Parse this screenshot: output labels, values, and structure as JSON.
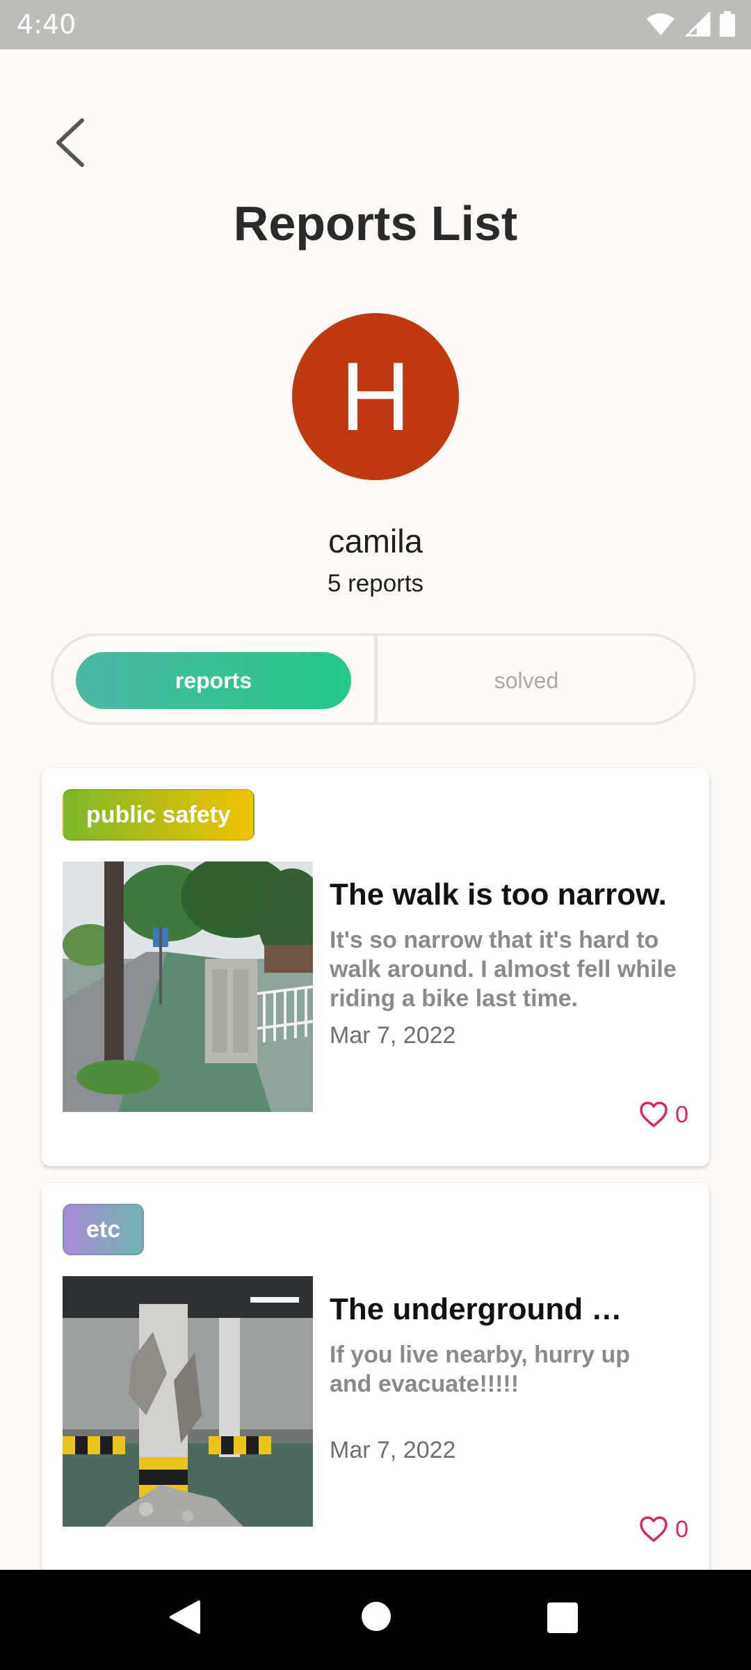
{
  "status_bar": {
    "time": "4:40",
    "icons": [
      "wifi-icon",
      "signal-icon",
      "battery-icon"
    ]
  },
  "header": {
    "back_icon": "chevron-left-icon",
    "title": "Reports List"
  },
  "profile": {
    "avatar_initial": "H",
    "avatar_color": "#C0380F",
    "name": "camila",
    "report_count": "5 reports"
  },
  "tabs": {
    "active": "reports",
    "items": [
      {
        "label": "reports"
      },
      {
        "label": "solved"
      }
    ]
  },
  "reports": [
    {
      "category": "public safety",
      "category_colors": [
        "#7DB82A",
        "#F2C200"
      ],
      "title": "The walk is too narrow.",
      "description": "It's so narrow that it's hard to walk around. I almost fell while riding a bike last time.",
      "date": "Mar 7, 2022",
      "likes": "0"
    },
    {
      "category": "etc",
      "category_colors": [
        "#A98BD8",
        "#6FB3AE"
      ],
      "title": "The underground …",
      "description": "If you live nearby, hurry up and evacuate!!!!!",
      "date": "Mar 7, 2022",
      "likes": "0"
    }
  ],
  "colors": {
    "background": "#FEFBF6",
    "accent": "#23C887",
    "like": "#D9245E"
  },
  "nav_bar": {
    "icons": [
      "back-triangle-icon",
      "home-circle-icon",
      "recents-square-icon"
    ]
  }
}
